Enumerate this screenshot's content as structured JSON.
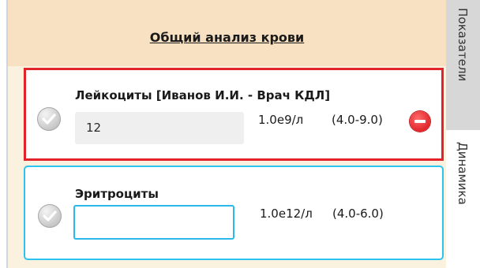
{
  "header": {
    "title": "Общий анализ крови"
  },
  "tests": [
    {
      "label": "Лейкоциты  [Иванов И.И. - Врач КДЛ]",
      "value": "12",
      "unit": "1.0e9/л",
      "range": "(4.0-9.0)",
      "status": "out-of-range"
    },
    {
      "label": "Эритроциты",
      "value": "",
      "unit": "1.0e12/л",
      "range": "(4.0-6.0)",
      "status": "editing"
    }
  ],
  "tabs": [
    {
      "label": "Показатели",
      "active": true
    },
    {
      "label": "Динамика",
      "active": false
    }
  ],
  "colors": {
    "header_bg": "#f7e1c2",
    "alert_border": "#e2232a",
    "focus_border": "#2bc3ef",
    "delete_button": "#e0262b"
  }
}
